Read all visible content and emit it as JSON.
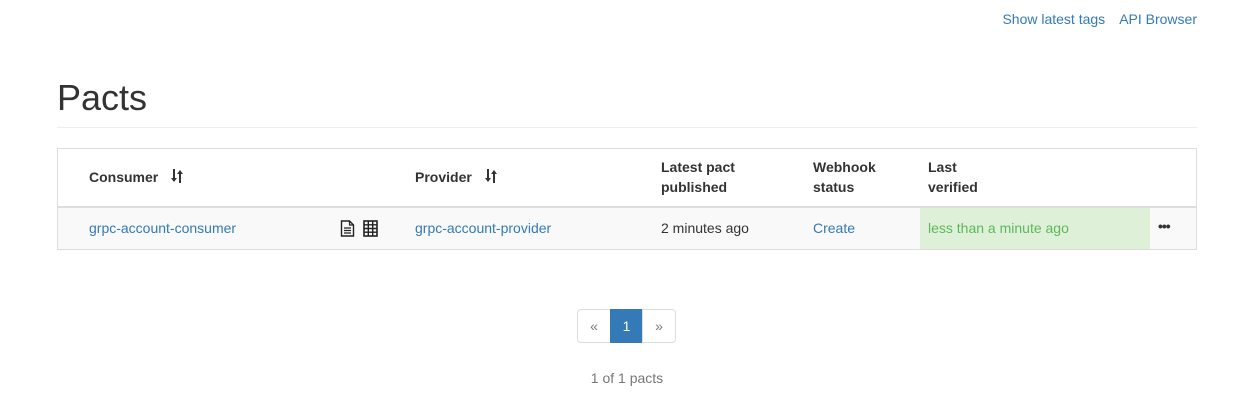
{
  "nav": {
    "show_latest_tags": "Show latest tags",
    "api_browser": "API Browser"
  },
  "page": {
    "title": "Pacts"
  },
  "table": {
    "headers": {
      "consumer": "Consumer",
      "provider": "Provider",
      "latest_pact_line1": "Latest pact",
      "latest_pact_line2": "published",
      "webhook_line1": "Webhook",
      "webhook_line2": "status",
      "verified_line1": "Last",
      "verified_line2": "verified"
    },
    "rows": [
      {
        "consumer": "grpc-account-consumer",
        "provider": "grpc-account-provider",
        "latest_pact_published": "2 minutes ago",
        "webhook_status": "Create",
        "last_verified": "less than a minute ago",
        "actions": "•••"
      }
    ],
    "icons": {
      "sort": "sort-icon",
      "document": "document-icon",
      "matrix": "matrix-grid-icon",
      "more": "ellipsis-icon"
    },
    "colors": {
      "verified_bg": "#dff0d8",
      "verified_text": "#5cb85c",
      "link": "#337ab7"
    }
  },
  "pagination": {
    "prev": "«",
    "current": "1",
    "next": "»",
    "summary": "1 of 1 pacts"
  }
}
